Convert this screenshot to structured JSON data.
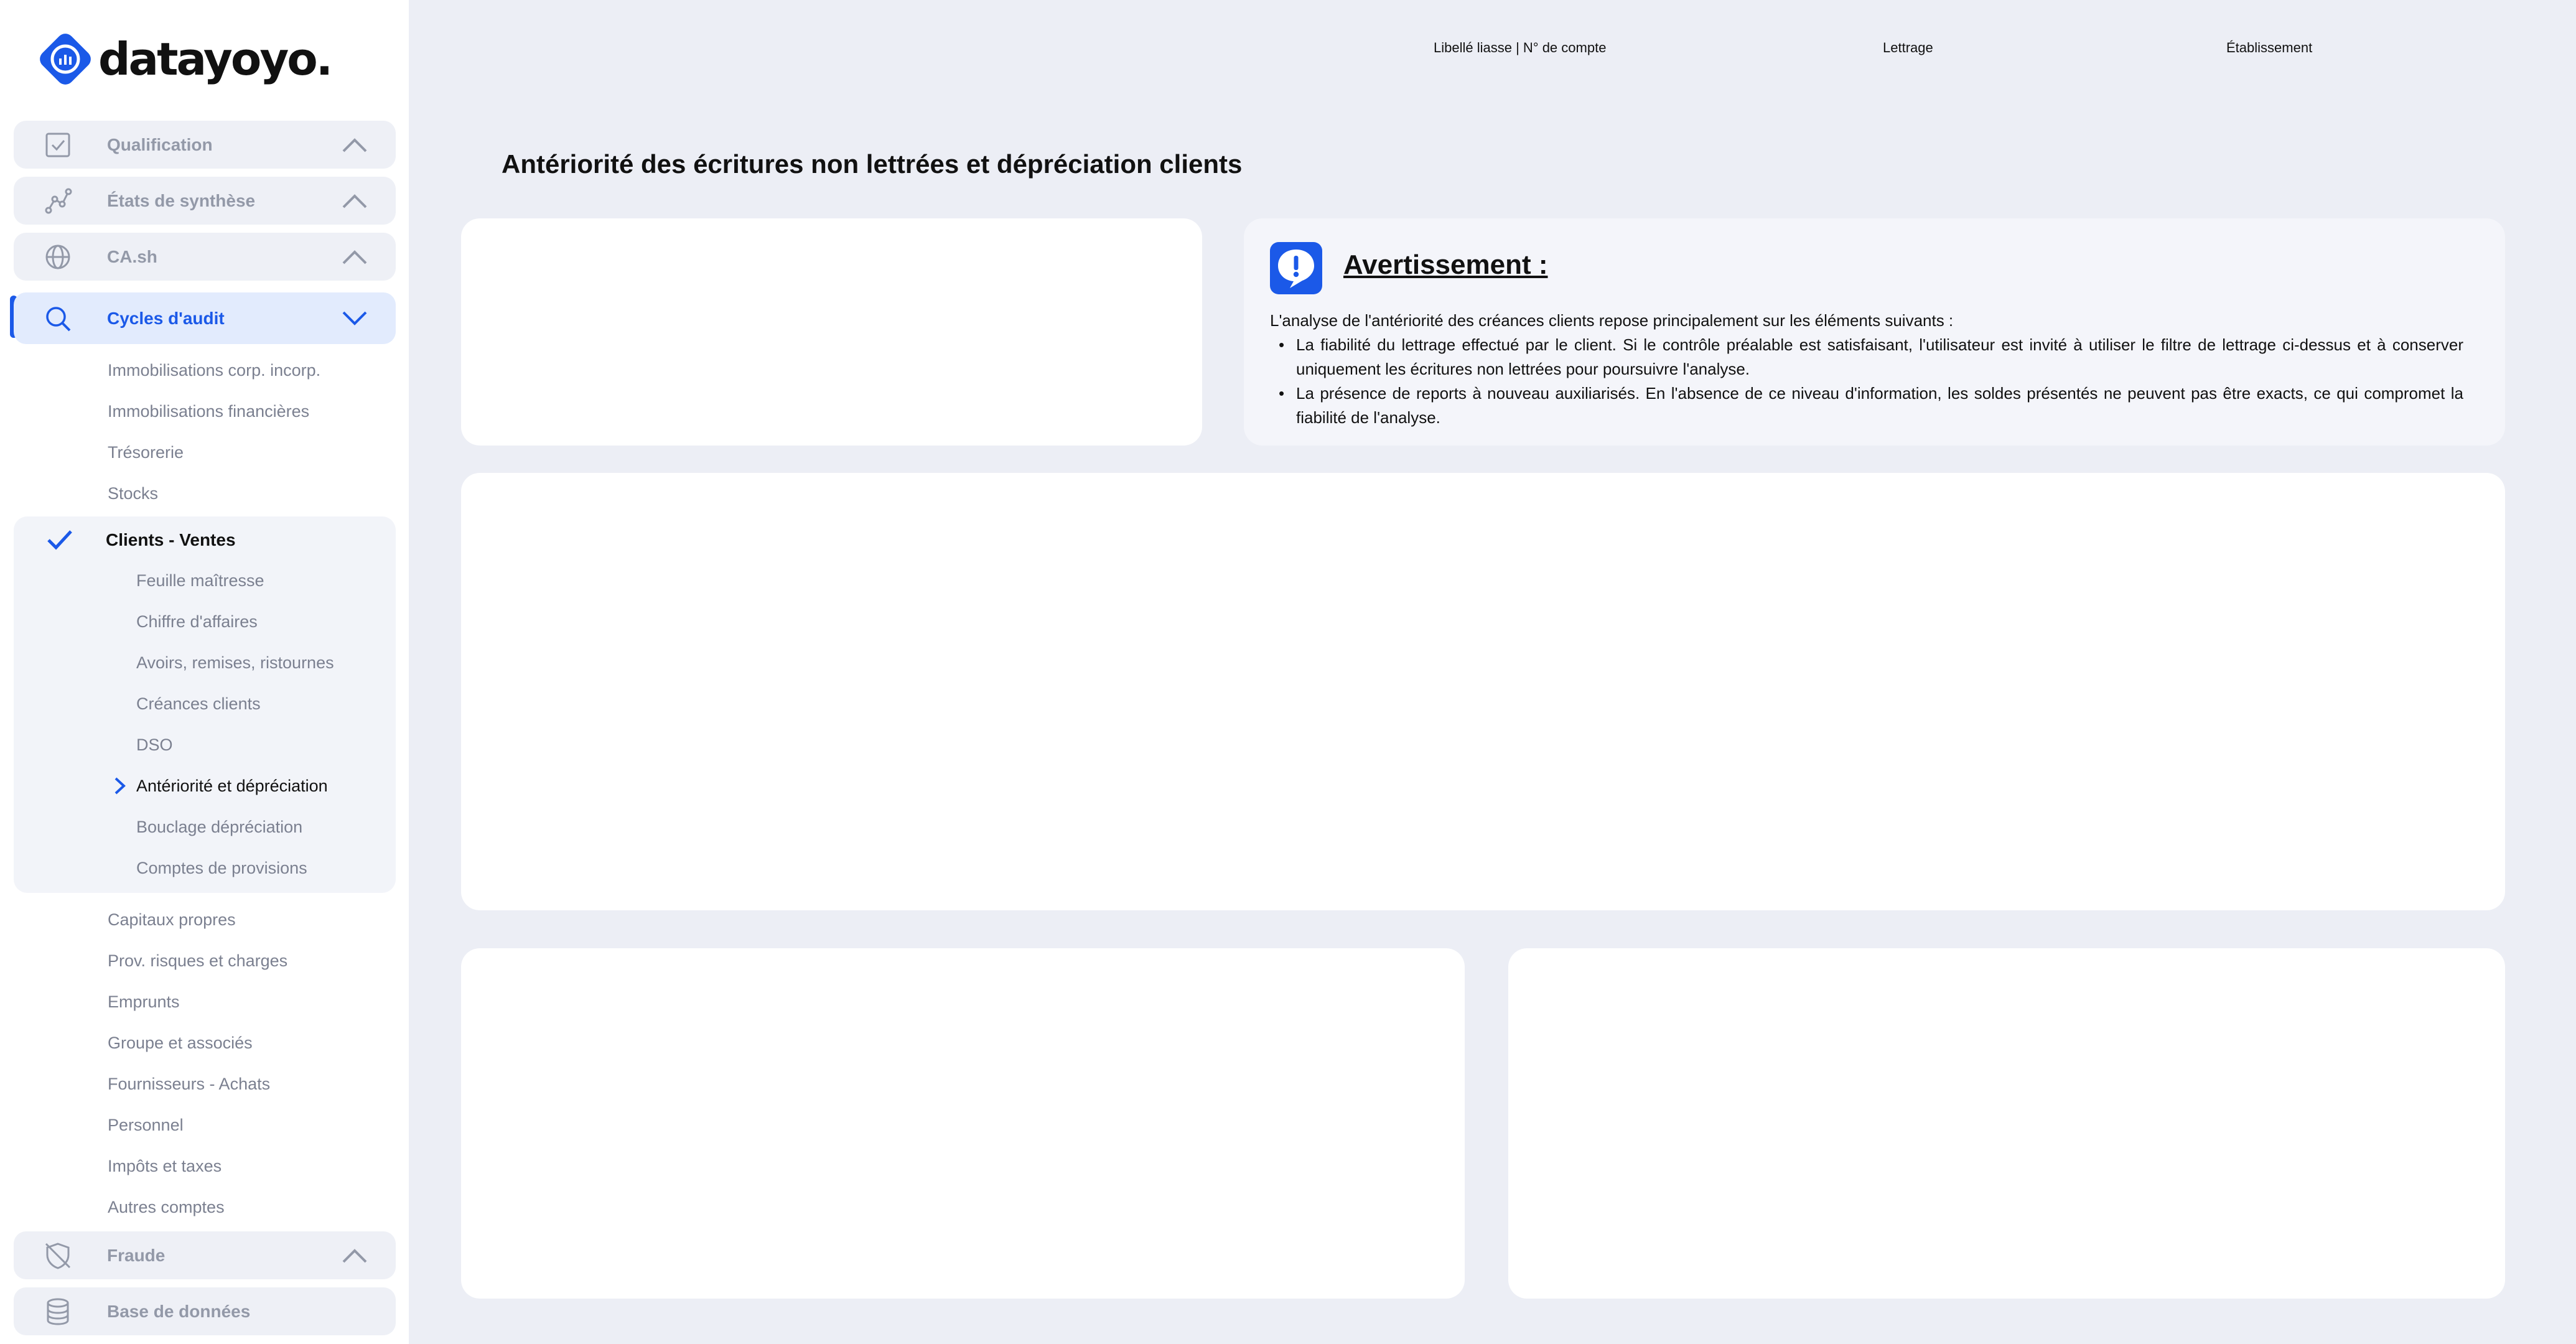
{
  "brand": {
    "name": "datayoyo",
    "dot": ".",
    "accent": "#1b59e8"
  },
  "sidebar": {
    "sections_top": [
      {
        "label": "Qualification",
        "icon": "checkbox-icon"
      },
      {
        "label": "États de synthèse",
        "icon": "chart-line-icon"
      },
      {
        "label": "CA.sh",
        "icon": "globe-icon"
      }
    ],
    "audit": {
      "label": "Cycles d'audit",
      "icon": "search-icon"
    },
    "audit_items_before": [
      "Immobilisations corp. incorp.",
      "Immobilisations financières",
      "Trésorerie",
      "Stocks"
    ],
    "clients_group": {
      "label": "Clients - Ventes",
      "items": [
        "Feuille maîtresse",
        "Chiffre d'affaires",
        "Avoirs, remises, ristournes",
        "Créances clients",
        "DSO",
        "Antériorité et dépréciation",
        "Bouclage dépréciation",
        "Comptes de provisions"
      ],
      "current_index": 5
    },
    "audit_items_after": [
      "Capitaux propres",
      "Prov. risques et charges",
      "Emprunts",
      "Groupe et associés",
      "Fournisseurs - Achats",
      "Personnel",
      "Impôts et taxes",
      "Autres comptes"
    ],
    "sections_bottom": [
      {
        "label": "Fraude",
        "icon": "shield-off-icon"
      },
      {
        "label": "Base de données",
        "icon": "database-icon"
      }
    ]
  },
  "header": {
    "filters": [
      "Libellé liasse | N° de compte",
      "Lettrage",
      "Établissement"
    ]
  },
  "page": {
    "title": "Antériorité des écritures non lettrées et dépréciation clients"
  },
  "warning": {
    "title": "Avertissement :",
    "intro": "L'analyse de l'antériorité des créances clients repose principalement sur les éléments suivants :",
    "bullets": [
      "La fiabilité du lettrage effectué par le client. Si le contrôle préalable est satisfaisant, l'utilisateur est invité à utiliser le filtre de lettrage ci-dessus et à conserver uniquement les écritures non lettrées pour poursuivre l'analyse.",
      "La présence de reports à nouveau auxiliarisés. En l'absence de ce niveau d'information, les soldes présentés ne peuvent pas être exacts, ce qui compromet la fiabilité de l'analyse."
    ]
  }
}
